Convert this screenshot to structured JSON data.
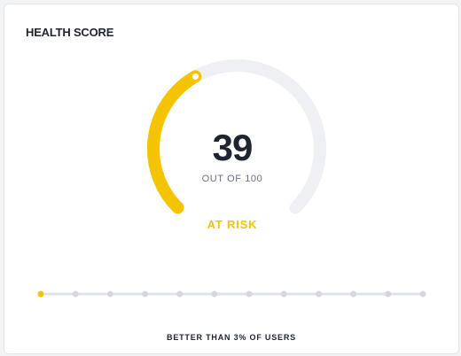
{
  "card": {
    "title": "HEALTH SCORE"
  },
  "gauge": {
    "score": "39",
    "max_label": "OUT OF 100",
    "score_value": 39,
    "max_value": 100,
    "status": "AT RISK"
  },
  "percentile": {
    "markers": 12,
    "active_marker": 0,
    "text": "BETTER THAN 3% OF USERS"
  },
  "colors": {
    "accent": "#f5c400",
    "track": "#eef0f4",
    "text": "#1f2430",
    "muted": "#6b7280",
    "marker": "#d4d7dd",
    "line": "#dfe2e7"
  }
}
